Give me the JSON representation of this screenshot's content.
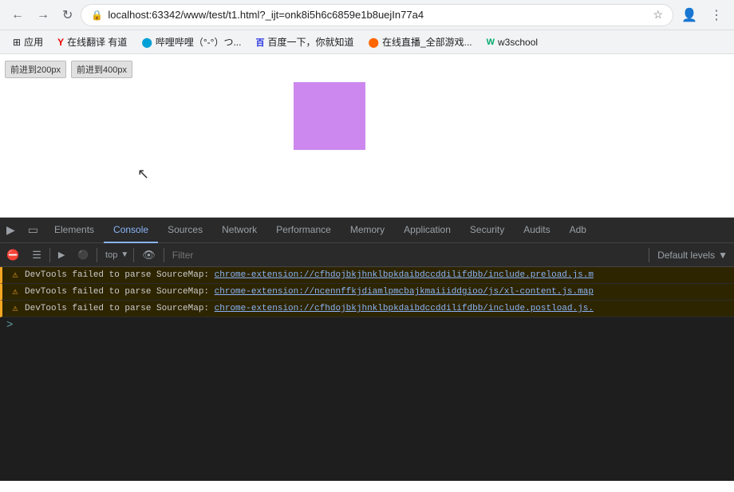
{
  "browser": {
    "nav": {
      "back_btn": "‹",
      "forward_btn": "›",
      "reload_btn": "↻",
      "address": "localhost:63342/www/test/t1.html?_ijt=onk8i5h6c6859e1b8uejIn77a4",
      "lock_icon": "🔒",
      "search_icon": "✕"
    },
    "bookmarks": [
      {
        "id": "apps",
        "icon": "⊞",
        "label": "应用"
      },
      {
        "id": "youdao",
        "icon": "Y",
        "label": "在线翻译 有道"
      },
      {
        "id": "bilibili",
        "icon": "●",
        "label": "哔哩哔哩（°-°）つ..."
      },
      {
        "id": "baidu",
        "icon": "百",
        "label": "百度一下，你就知道"
      },
      {
        "id": "live",
        "icon": "●",
        "label": "在线直播_全部游戏..."
      },
      {
        "id": "w3school",
        "icon": "W",
        "label": "w3school"
      }
    ]
  },
  "page": {
    "btn1_label": "前进到200px",
    "btn2_label": "前进到400px"
  },
  "devtools": {
    "tabs": [
      {
        "id": "elements",
        "label": "Elements",
        "active": false
      },
      {
        "id": "console",
        "label": "Console",
        "active": true
      },
      {
        "id": "sources",
        "label": "Sources",
        "active": false
      },
      {
        "id": "network",
        "label": "Network",
        "active": false
      },
      {
        "id": "performance",
        "label": "Performance",
        "active": false
      },
      {
        "id": "memory",
        "label": "Memory",
        "active": false
      },
      {
        "id": "application",
        "label": "Application",
        "active": false
      },
      {
        "id": "security",
        "label": "Security",
        "active": false
      },
      {
        "id": "audits",
        "label": "Audits",
        "active": false
      },
      {
        "id": "adb",
        "label": "Adb",
        "active": false
      }
    ],
    "filter_placeholder": "Filter",
    "levels_label": "Default levels",
    "context_selector": "top",
    "logs": [
      {
        "type": "warning",
        "message": "DevTools failed to parse SourceMap: ",
        "link": "chrome-extension://cfhdojbkjhnklbpkdaibdccddilifdbb/include.preload.js.m"
      },
      {
        "type": "warning",
        "message": "DevTools failed to parse SourceMap: ",
        "link": "chrome-extension://ncennffkjdiamlpmcbajkmaiiiddgioo/js/xl-content.js.map"
      },
      {
        "type": "warning",
        "message": "DevTools failed to parse SourceMap: ",
        "link": "chrome-extension://cfhdojbkjhnklbpkdaibdccddilifdbb/include.postload.js."
      }
    ],
    "prompt_symbol": ">"
  }
}
